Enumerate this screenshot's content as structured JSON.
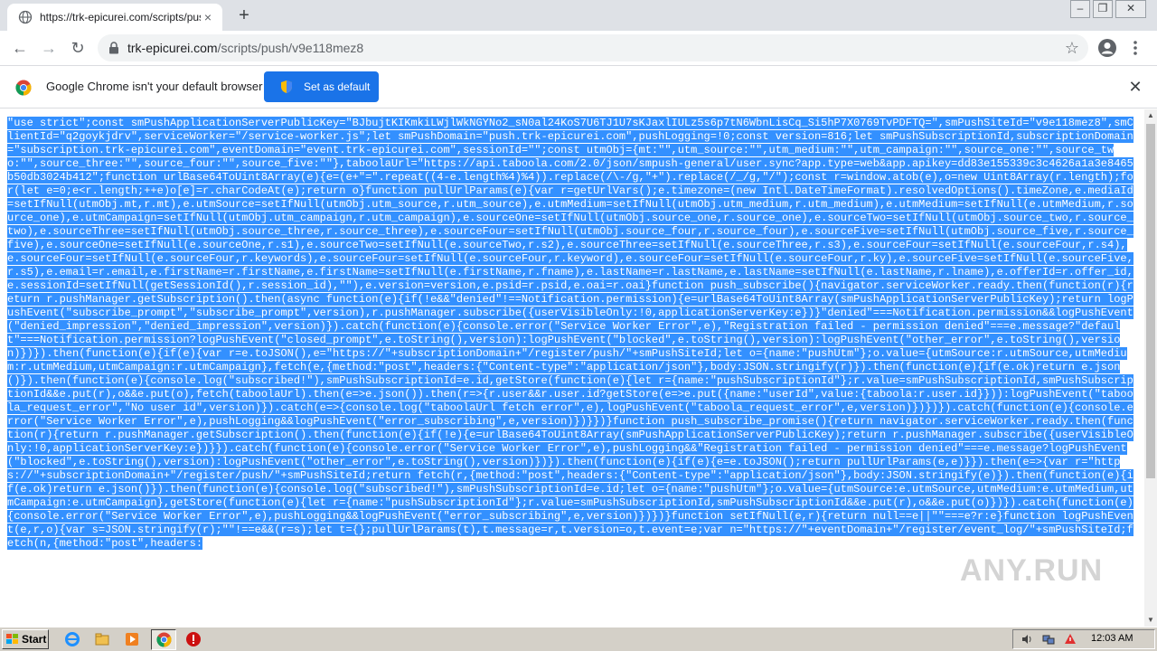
{
  "tab": {
    "title": "https://trk-epicurei.com/scripts/push/v9e118mez8",
    "close_glyph": "×"
  },
  "new_tab_glyph": "+",
  "window_controls": {
    "minimize": "–",
    "restore": "❐",
    "close": "✕"
  },
  "toolbar": {
    "url_host": "trk-epicurei.com",
    "url_path": "/scripts/push/v9e118mez8",
    "back_glyph": "←",
    "forward_glyph": "→",
    "reload_glyph": "↻",
    "star_glyph": "☆"
  },
  "infobar": {
    "message": "Google Chrome isn't your default browser",
    "button_label": "Set as default",
    "close_glyph": "✕"
  },
  "content": {
    "code_text": "\"use strict\";const smPushApplicationServerPublicKey=\"BJbujtKIKmkiLWjlWkNGYNo2_sN0al24KoS7U6TJ1U7sKJaxlIULz5s6p7tN6WbnLisCq_Si5hP7X0769TvPDFTQ=\",smPushSiteId=\"v9e118mez8\",smClientId=\"q2goykjdrv\",serviceWorker=\"/service-worker.js\";let smPushDomain=\"push.trk-epicurei.com\",pushLogging=!0;const version=816;let smPushSubscriptionId,subscriptionDomain=\"subscription.trk-epicurei.com\",eventDomain=\"event.trk-epicurei.com\",sessionId=\"\";const utmObj={mt:\"\",utm_source:\"\",utm_medium:\"\",utm_campaign:\"\",source_one:\"\",source_two:\"\",source_three:\"\",source_four:\"\",source_five:\"\"},taboolaUrl=\"https://api.taboola.com/2.0/json/smpush-general/user.sync?app.type=web&app.apikey=dd83e155339c3c4626a1a3e8465b50db3024b412\";function urlBase64ToUint8Array(e){e=(e+\"=\".repeat((4-e.length%4)%4)).replace(/\\-/g,\"+\").replace(/_/g,\"/\");const r=window.atob(e),o=new Uint8Array(r.length);for(let e=0;e<r.length;++e)o[e]=r.charCodeAt(e);return o}function pullUrlParams(e){var r=getUrlVars();e.timezone=(new Intl.DateTimeFormat).resolvedOptions().timeZone,e.mediaId=setIfNull(utmObj.mt,r.mt),e.utmSource=setIfNull(utmObj.utm_source,r.utm_source),e.utmMedium=setIfNull(utmObj.utm_medium,r.utm_medium),e.utmMedium=setIfNull(e.utmMedium,r.source_one),e.utmCampaign=setIfNull(utmObj.utm_campaign,r.utm_campaign),e.sourceOne=setIfNull(utmObj.source_one,r.source_one),e.sourceTwo=setIfNull(utmObj.source_two,r.source_two),e.sourceThree=setIfNull(utmObj.source_three,r.source_three),e.sourceFour=setIfNull(utmObj.source_four,r.source_four),e.sourceFive=setIfNull(utmObj.source_five,r.source_five),e.sourceOne=setIfNull(e.sourceOne,r.s1),e.sourceTwo=setIfNull(e.sourceTwo,r.s2),e.sourceThree=setIfNull(e.sourceThree,r.s3),e.sourceFour=setIfNull(e.sourceFour,r.s4),e.sourceFour=setIfNull(e.sourceFour,r.keywords),e.sourceFour=setIfNull(e.sourceFour,r.keyword),e.sourceFour=setIfNull(e.sourceFour,r.ky),e.sourceFive=setIfNull(e.sourceFive,r.s5),e.email=r.email,e.firstName=r.firstName,e.firstName=setIfNull(e.firstName,r.fname),e.lastName=r.lastName,e.lastName=setIfNull(e.lastName,r.lname),e.offerId=r.offer_id,e.sessionId=setIfNull(getSessionId(),r.session_id),\"\"),e.version=version,e.psid=r.psid,e.oai=r.oai}function push_subscribe(){navigator.serviceWorker.ready.then(function(r){return r.pushManager.getSubscription().then(async function(e){if(!e&&\"denied\"!==Notification.permission){e=urlBase64ToUint8Array(smPushApplicationServerPublicKey);return logPushEvent(\"subscribe_prompt\",\"subscribe_prompt\",version),r.pushManager.subscribe({userVisibleOnly:!0,applicationServerKey:e})}\"denied\"===Notification.permission&&logPushEvent(\"denied_impression\",\"denied_impression\",version)}).catch(function(e){console.error(\"Service Worker Error\",e),\"Registration failed - permission denied\"===e.message?\"default\"===Notification.permission?logPushEvent(\"closed_prompt\",e.toString(),version):logPushEvent(\"blocked\",e.toString(),version):logPushEvent(\"other_error\",e.toString(),version)})}).then(function(e){if(e){var r=e.toJSON(),e=\"https://\"+subscriptionDomain+\"/register/push/\"+smPushSiteId;let o={name:\"pushUtm\"};o.value={utmSource:r.utmSource,utmMedium:r.utmMedium,utmCampaign:r.utmCampaign},fetch(e,{method:\"post\",headers:{\"Content-type\":\"application/json\"},body:JSON.stringify(r)}).then(function(e){if(e.ok)return e.json()}).then(function(e){console.log(\"subscribed!\"),smPushSubscriptionId=e.id,getStore(function(e){let r={name:\"pushSubscriptionId\"};r.value=smPushSubscriptionId,smPushSubscriptionId&&e.put(r),o&&e.put(o),fetch(taboolaUrl).then(e=>e.json()).then(r=>{r.user&&r.user.id?getStore(e=>e.put({name:\"userId\",value:{taboola:r.user.id}})):logPushEvent(\"taboola_request_error\",\"No user id\",version)}).catch(e=>{console.log(\"taboolaUrl fetch error\",e),logPushEvent(\"taboola_request_error\",e,version)})})}).catch(function(e){console.error(\"Service Worker Error\",e),pushLogging&&logPushEvent(\"error_subscribing\",e,version)})}})}function push_subscribe_promise(){return navigator.serviceWorker.ready.then(function(r){return r.pushManager.getSubscription().then(function(e){if(!e){e=urlBase64ToUint8Array(smPushApplicationServerPublicKey);return r.pushManager.subscribe({userVisibleOnly:!0,applicationServerKey:e})}}).catch(function(e){console.error(\"Service Worker Error\",e),pushLogging&&\"Registration failed - permission denied\"===e.message?logPushEvent(\"blocked\",e.toString(),version):logPushEvent(\"other_error\",e.toString(),version)})}).then(function(e){if(e){e=e.toJSON();return pullUrlParams(e,e)}}).then(e=>{var r=\"https://\"+subscriptionDomain+\"/register/push/\"+smPushSiteId;return fetch(r,{method:\"post\",headers:{\"Content-type\":\"application/json\"},body:JSON.stringify(e)}).then(function(e){if(e.ok)return e.json()}).then(function(e){console.log(\"subscribed!\"),smPushSubscriptionId=e.id;let o={name:\"pushUtm\"};o.value={utmSource:e.utmSource,utmMedium:e.utmMedium,utmCampaign:e.utmCampaign},getStore(function(e){let r={name:\"pushSubscriptionId\"};r.value=smPushSubscriptionId,smPushSubscriptionId&&e.put(r),o&&e.put(o)})}).catch(function(e){console.error(\"Service Worker Error\",e),pushLogging&&logPushEvent(\"error_subscribing\",e,version)})})}function setIfNull(e,r){return null==e||\"\"===e?r:e}function logPushEvent(e,r,o){var s=JSON.stringify(r);\"\"!==e&&(r=s);let t={};pullUrlParams(t),t.message=r,t.version=o,t.event=e;var n=\"https://\"+eventDomain+\"/register/event_log/\"+smPushSiteId;fetch(n,{method:\"post\",headers:"
  },
  "watermark": "ANY.RUN",
  "taskbar": {
    "start_label": "Start",
    "clock": "12:03 AM"
  },
  "colors": {
    "selection": "#3390ff",
    "accent_button": "#1a73e8",
    "tabstrip": "#dee1e6"
  }
}
